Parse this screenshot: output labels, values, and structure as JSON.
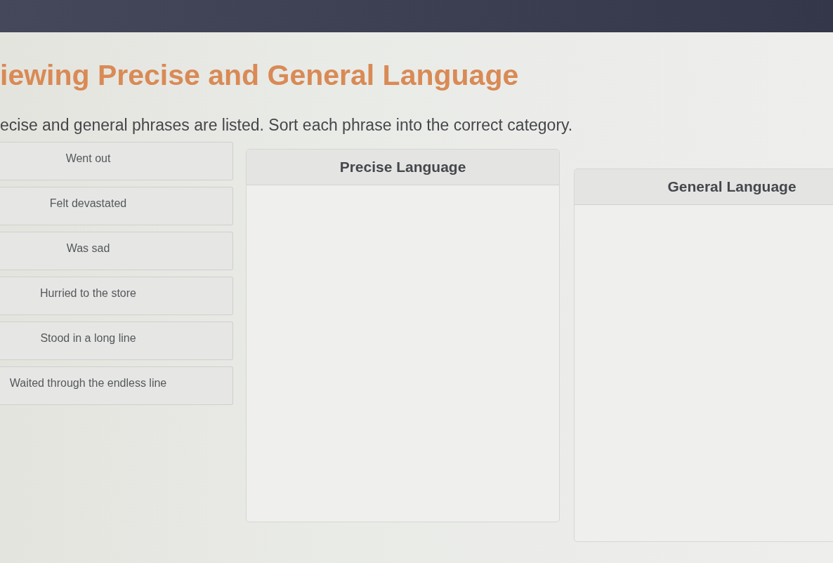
{
  "header": {
    "title": "iewing Precise and General Language",
    "instructions": "ecise and general phrases are listed. Sort each phrase into the correct category."
  },
  "phrases": [
    {
      "label": "Went out"
    },
    {
      "label": "Felt devastated"
    },
    {
      "label": "Was sad"
    },
    {
      "label": "Hurried to the store"
    },
    {
      "label": "Stood in a long line"
    },
    {
      "label": "Waited through the endless line"
    }
  ],
  "categories": [
    {
      "title": "Precise Language"
    },
    {
      "title": "General Language"
    }
  ]
}
